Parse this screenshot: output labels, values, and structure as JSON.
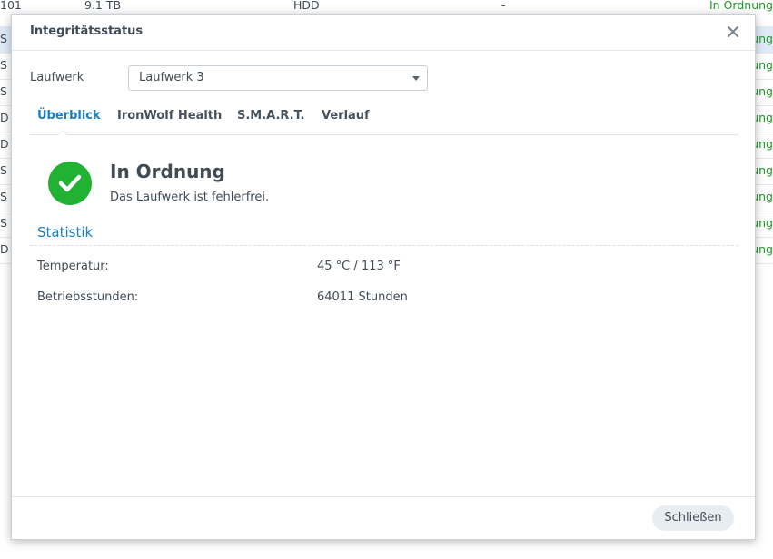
{
  "background_table": {
    "rows": [
      {
        "c1": "101",
        "c2": "9.1 TB",
        "c3": "HDD",
        "c4": "-",
        "c5": "In Ordnung",
        "selected": false
      },
      {
        "c1": "S",
        "c5": "In Ordnung",
        "selected": true
      },
      {
        "c1": "S",
        "c5": "In Ordnung",
        "selected": false
      },
      {
        "c1": "S",
        "c5": "In Ordnung",
        "selected": false
      },
      {
        "c1": "D",
        "c5": "In Ordnung",
        "selected": false
      },
      {
        "c1": "D",
        "c5": "In Ordnung",
        "selected": false
      },
      {
        "c1": "S",
        "c5": "In Ordnung",
        "selected": false
      },
      {
        "c1": "S",
        "c5": "In Ordnung",
        "selected": false
      },
      {
        "c1": "S",
        "c5": "In Ordnung",
        "selected": false
      },
      {
        "c1": "D",
        "c5": "In Ordnung",
        "selected": false
      }
    ]
  },
  "dialog": {
    "title": "Integritätsstatus",
    "close_icon": "close-icon",
    "drive_label": "Laufwerk",
    "drive_selected": "Laufwerk 3",
    "tabs": [
      {
        "label": "Überblick",
        "active": true
      },
      {
        "label": "IronWolf Health",
        "active": false
      },
      {
        "label": "S.M.A.R.T.",
        "active": false
      },
      {
        "label": "Verlauf",
        "active": false
      }
    ],
    "status": {
      "icon": "check-circle-icon",
      "color": "#21b234",
      "title": "In Ordnung",
      "subtitle": "Das Laufwerk ist fehlerfrei."
    },
    "section_title": "Statistik",
    "stats": [
      {
        "label": "Temperatur:",
        "value": "45 °C / 113 °F"
      },
      {
        "label": "Betriebsstunden:",
        "value": "64011 Stunden"
      }
    ],
    "footer_button": "Schließen"
  },
  "colors": {
    "accent": "#1b7fc1",
    "ok_green": "#1f9a2a",
    "selected_row": "#dfeaf6"
  }
}
